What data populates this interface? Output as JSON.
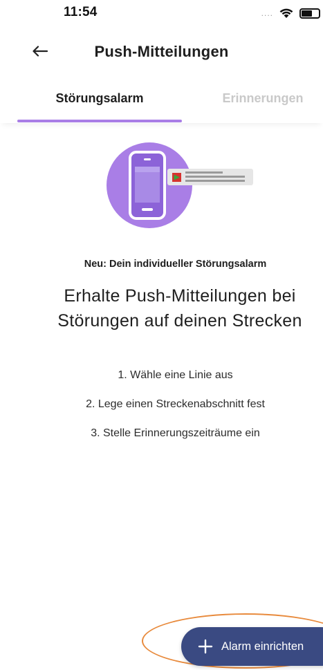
{
  "status_bar": {
    "time": "11:54",
    "signal": "....",
    "icons": [
      "wifi-icon",
      "battery-icon"
    ]
  },
  "header": {
    "back_icon": "arrow-left-icon",
    "title": "Push-Mitteilungen"
  },
  "tabs": [
    {
      "label": "Störungsalarm",
      "active": true
    },
    {
      "label": "Erinnerungen",
      "active": false
    }
  ],
  "illustration": {
    "icon": "phone-notification-icon",
    "colors": {
      "circle": "#a97ee6",
      "phone": "#8c63d8",
      "notification": "#e6e6e6"
    }
  },
  "content": {
    "new_label": "Neu: Dein individueller Störungsalarm",
    "headline_line1": "Erhalte Push-Mitteilungen bei",
    "headline_line2": "Störungen auf deinen Strecken",
    "steps": [
      "1. Wähle eine Linie aus",
      "2. Lege einen Streckenabschnitt fest",
      "3. Stelle Erinnerungszeiträume ein"
    ]
  },
  "fab": {
    "icon": "plus-icon",
    "label": "Alarm einrichten"
  },
  "colors": {
    "accent": "#a97ee6",
    "fab": "#3a4a82",
    "highlight": "#e88a3c"
  }
}
